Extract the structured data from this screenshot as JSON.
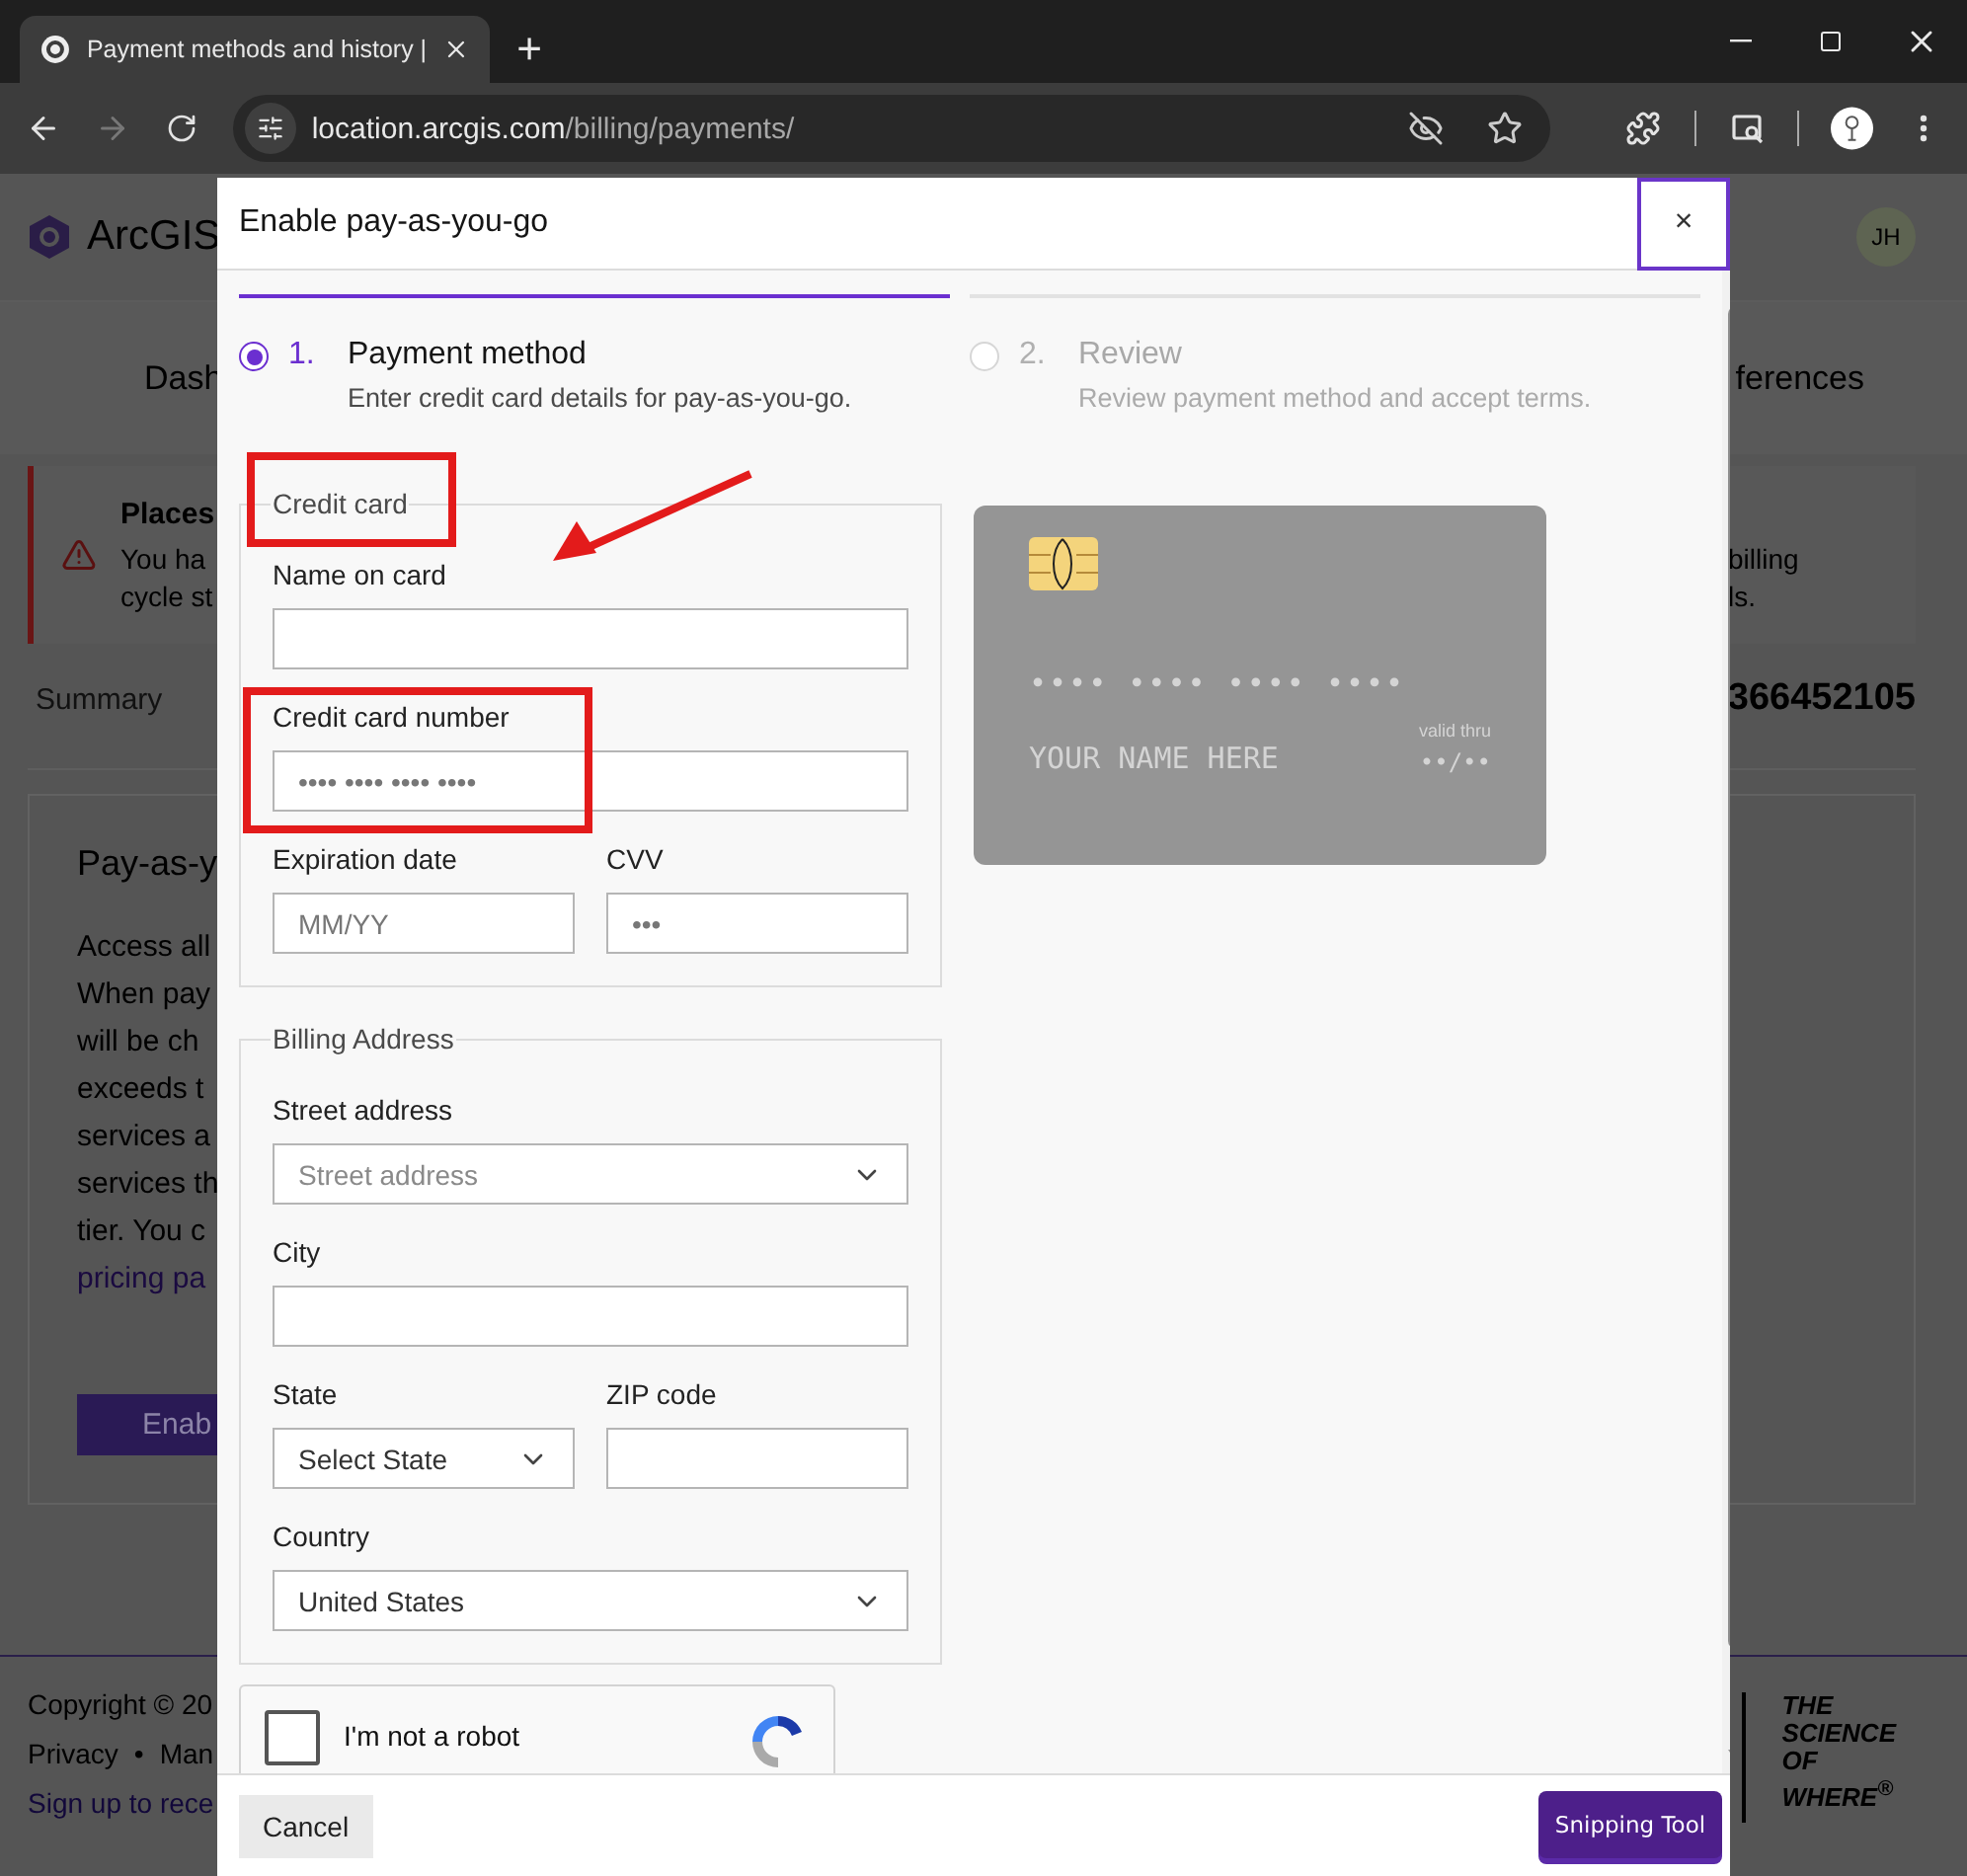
{
  "browser": {
    "tab_title": "Payment methods and history |",
    "new_tab": "+",
    "url_host": "location.arcgis.com",
    "url_path": "/billing/payments/",
    "forward_disabled": true
  },
  "background": {
    "logo_text": "ArcGIS",
    "avatar": "JH",
    "nav_left": "Dash",
    "nav_right": "ferences",
    "alert_title": "Places",
    "alert_left_lines": [
      "You ha",
      "cycle st"
    ],
    "alert_right_lines": [
      "billing",
      "ls."
    ],
    "summary": "Summary",
    "account_number": "366452105",
    "card_title": "Pay-as-y",
    "card_lines": [
      "Access all",
      "When pay",
      "will be ch",
      "exceeds t",
      "services a",
      "services th",
      "tier. You c"
    ],
    "card_link": "pricing pa",
    "card_button": "Enab",
    "copyright": "Copyright © 20",
    "footer_links": [
      "Privacy",
      "Man"
    ],
    "footer_separator": "•",
    "signup": "Sign up to rece",
    "brand_lines": [
      "THE",
      "SCIENCE",
      "OF",
      "WHERE$^{®}$"
    ]
  },
  "modal": {
    "title": "Enable pay-as-you-go",
    "close": "×",
    "close_focused": true,
    "steps": [
      {
        "number": "1.",
        "title": "Payment method",
        "description": "Enter credit card details for pay-as-you-go.",
        "selected": true
      },
      {
        "number": "2.",
        "title": "Review",
        "description": "Review payment method and accept terms.",
        "selected": false
      }
    ],
    "credit_card": {
      "legend": "Credit card",
      "rows": [
        [
          {
            "kind": "input",
            "label": "Name on card"
          }
        ],
        [
          {
            "kind": "input",
            "label": "Credit card number",
            "placeholder": "•••• •••• •••• ••••"
          }
        ],
        [
          {
            "kind": "input",
            "label": "Expiration date",
            "placeholder": "MM/YY"
          },
          {
            "kind": "input",
            "label": "CVV",
            "placeholder": "•••"
          }
        ]
      ]
    },
    "billing": {
      "legend": "Billing Address",
      "rows": [
        [
          {
            "kind": "select",
            "label": "Street address",
            "placeholder": "Street address"
          }
        ],
        [
          {
            "kind": "input",
            "label": "City"
          }
        ],
        [
          {
            "kind": "select",
            "label": "State",
            "value": "Select State"
          },
          {
            "kind": "input",
            "label": "ZIP code"
          }
        ],
        [
          {
            "kind": "select",
            "label": "Country",
            "value": "United States"
          }
        ]
      ]
    },
    "card_preview": {
      "number": "•••• •••• •••• ••••",
      "name": "YOUR NAME HERE",
      "valid_label": "valid thru",
      "expiry": "••/••"
    },
    "captcha": {
      "label": "I'm not a robot",
      "checked": false
    },
    "cancel": "Cancel"
  },
  "notification": {
    "label": "Snipping Tool"
  }
}
